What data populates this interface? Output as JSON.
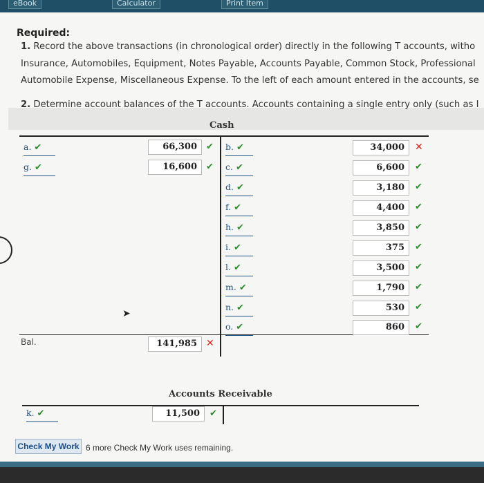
{
  "toolbar": {
    "tabs": [
      "eBook",
      "Calculator",
      "Print Item"
    ]
  },
  "heading": "Required:",
  "instructions": {
    "item1_num": "1.",
    "item1_line1": "Record the above transactions (in chronological order) directly in the following T accounts, witho",
    "item1_line2": "Insurance, Automobiles, Equipment, Notes Payable, Accounts Payable, Common Stock, Professional",
    "item1_line3": "Automobile Expense, Miscellaneous Expense. To the left of each amount entered in the accounts, se",
    "item2_num": "2.",
    "item2_line1": "Determine account balances of the T accounts. Accounts containing a single entry only (such as I"
  },
  "cash": {
    "title": "Cash",
    "debits": [
      {
        "label": "a.",
        "amount": "66,300"
      },
      {
        "label": "g.",
        "amount": "16,600"
      }
    ],
    "credits": [
      {
        "label": "b.",
        "amount": "34,000",
        "status": "incorrect"
      },
      {
        "label": "c.",
        "amount": "6,600",
        "status": "correct"
      },
      {
        "label": "d.",
        "amount": "3,180",
        "status": "correct"
      },
      {
        "label": "f.",
        "amount": "4,400",
        "status": "correct"
      },
      {
        "label": "h.",
        "amount": "3,850",
        "status": "correct"
      },
      {
        "label": "i.",
        "amount": "375",
        "status": "correct"
      },
      {
        "label": "l.",
        "amount": "3,500",
        "status": "correct"
      },
      {
        "label": "m.",
        "amount": "1,790",
        "status": "correct"
      },
      {
        "label": "n.",
        "amount": "530",
        "status": "correct"
      },
      {
        "label": "o.",
        "amount": "860",
        "status": "correct"
      }
    ],
    "balance_label": "Bal.",
    "balance": "141,985",
    "balance_status": "incorrect"
  },
  "accounts_receivable": {
    "title": "Accounts Receivable",
    "debits": [
      {
        "label": "k.",
        "amount": "11,500",
        "status": "correct"
      }
    ]
  },
  "footer": {
    "check_button": "Check My Work",
    "remaining_text": "6 more Check My Work uses remaining."
  },
  "colors": {
    "correct": "#2e8b2e",
    "incorrect": "#d8261c",
    "label": "#1c4f80"
  }
}
